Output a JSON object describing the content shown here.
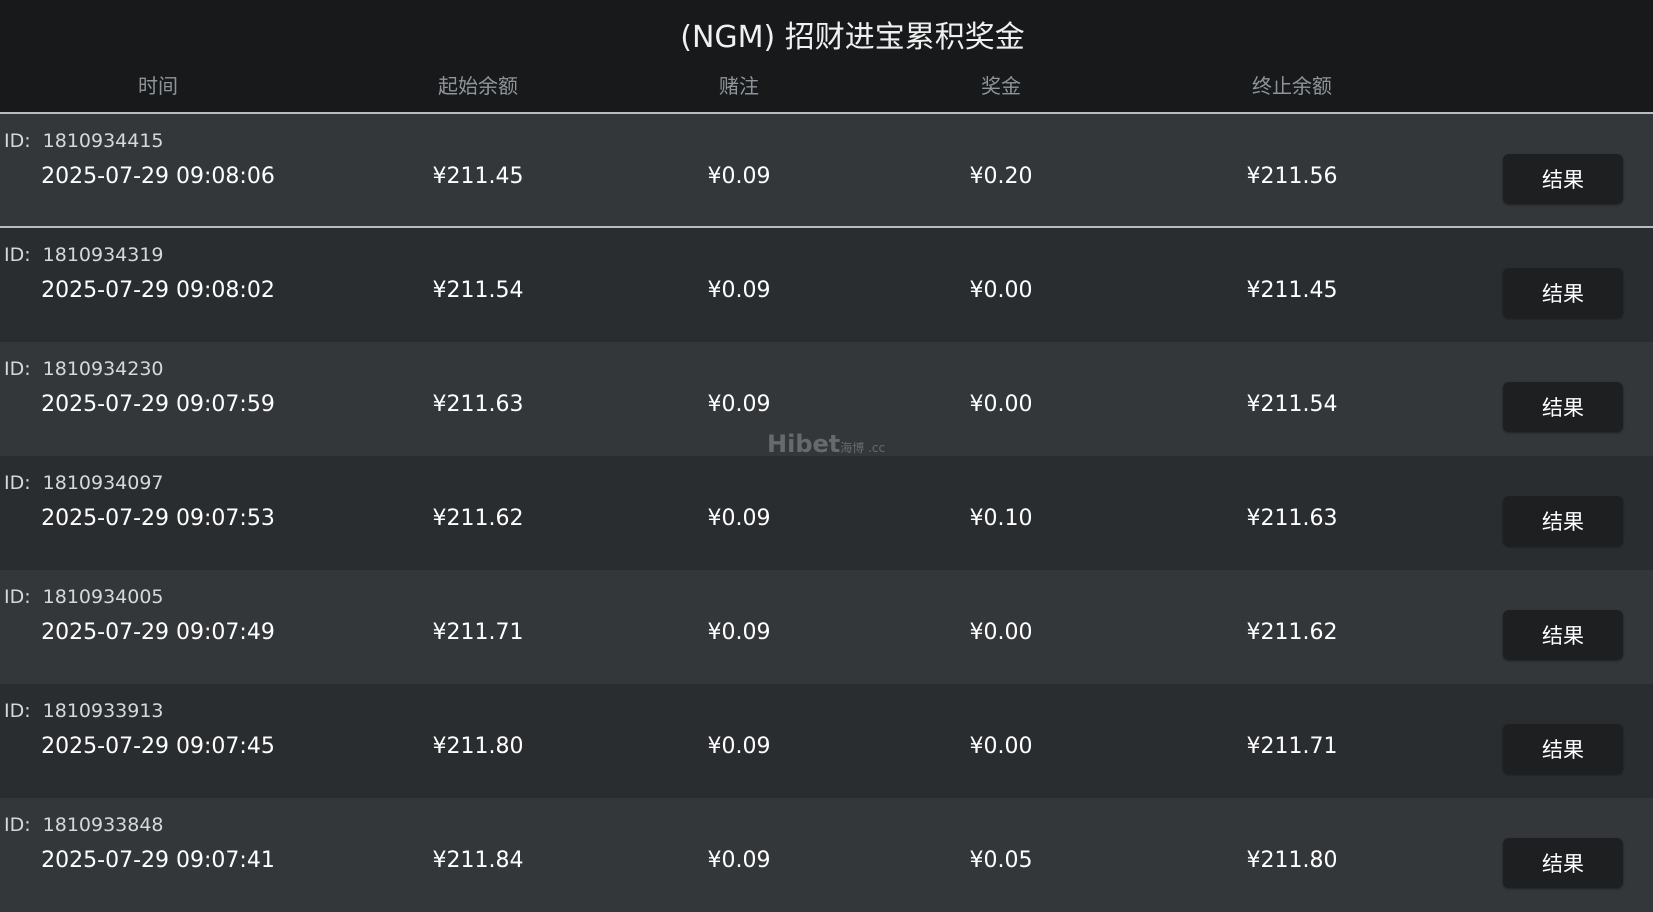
{
  "header": {
    "title": "(NGM) 招财进宝累积奖金",
    "columns": {
      "time": "时间",
      "start": "起始余额",
      "bet": "赌注",
      "prize": "奖金",
      "end": "终止余额"
    }
  },
  "id_label": "ID:",
  "result_label": "结果",
  "rows": [
    {
      "id": "1810934415",
      "time": "2025-07-29 09:08:06",
      "start": "¥211.45",
      "bet": "¥0.09",
      "prize": "¥0.20",
      "end": "¥211.56"
    },
    {
      "id": "1810934319",
      "time": "2025-07-29 09:08:02",
      "start": "¥211.54",
      "bet": "¥0.09",
      "prize": "¥0.00",
      "end": "¥211.45"
    },
    {
      "id": "1810934230",
      "time": "2025-07-29 09:07:59",
      "start": "¥211.63",
      "bet": "¥0.09",
      "prize": "¥0.00",
      "end": "¥211.54"
    },
    {
      "id": "1810934097",
      "time": "2025-07-29 09:07:53",
      "start": "¥211.62",
      "bet": "¥0.09",
      "prize": "¥0.10",
      "end": "¥211.63"
    },
    {
      "id": "1810934005",
      "time": "2025-07-29 09:07:49",
      "start": "¥211.71",
      "bet": "¥0.09",
      "prize": "¥0.00",
      "end": "¥211.62"
    },
    {
      "id": "1810933913",
      "time": "2025-07-29 09:07:45",
      "start": "¥211.80",
      "bet": "¥0.09",
      "prize": "¥0.00",
      "end": "¥211.71"
    },
    {
      "id": "1810933848",
      "time": "2025-07-29 09:07:41",
      "start": "¥211.84",
      "bet": "¥0.09",
      "prize": "¥0.05",
      "end": "¥211.80"
    }
  ],
  "watermark": {
    "brand": "Hibet",
    "suffix": "海博 .cc"
  }
}
